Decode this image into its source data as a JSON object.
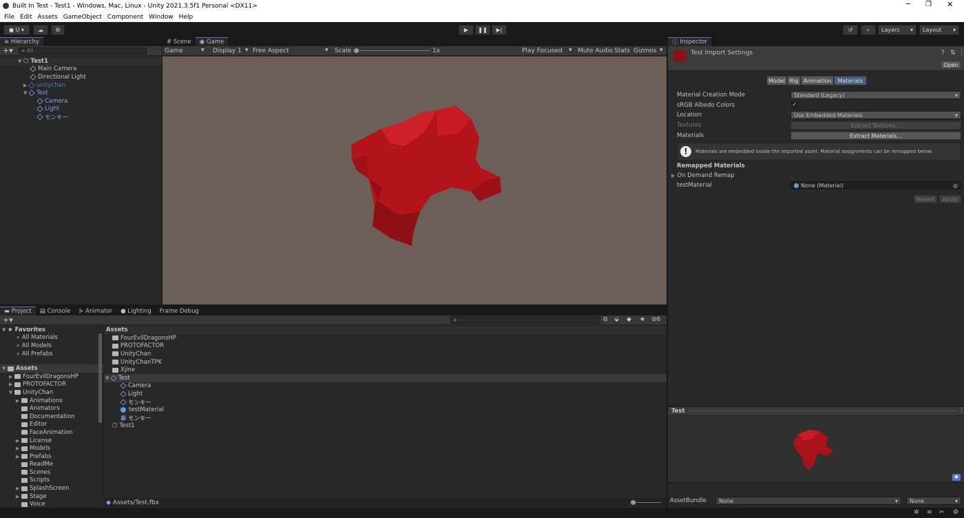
{
  "window": {
    "title": "Built In Test - Test1 - Windows, Mac, Linux - Unity 2021.3.5f1 Personal <DX11>"
  },
  "menu": [
    "File",
    "Edit",
    "Assets",
    "GameObject",
    "Component",
    "Window",
    "Help"
  ],
  "toolbar": {
    "account": "U",
    "layers": "Layers",
    "layout": "Layout"
  },
  "hierarchy": {
    "tab": "Hierarchy",
    "search_placeholder": "All",
    "scene": "Test1",
    "items": [
      {
        "label": "Main Camera"
      },
      {
        "label": "Directional Light"
      },
      {
        "label": "unitychan"
      },
      {
        "label": "Test"
      },
      {
        "label": "Camera"
      },
      {
        "label": "Light"
      },
      {
        "label": "モンキー"
      }
    ]
  },
  "game_view": {
    "tabs": [
      "Scene",
      "Game"
    ],
    "display_mode": "Game",
    "display": "Display 1",
    "aspect": "Free Aspect",
    "scale_label": "Scale",
    "scale_value": "1x",
    "play_focused": "Play Focused",
    "mute_audio": "Mute Audio",
    "stats": "Stats",
    "gizmos": "Gizmos"
  },
  "inspector": {
    "tab": "Inspector",
    "title": "Test Import Settings",
    "open_label": "Open",
    "tabs": [
      "Model",
      "Rig",
      "Animation",
      "Materials"
    ],
    "rows": {
      "creation_mode_label": "Material Creation Mode",
      "creation_mode_value": "Standard (Legacy)",
      "srgb_label": "sRGB Albedo Colors",
      "location_label": "Location",
      "location_value": "Use Embedded Materials",
      "textures_label": "Textures",
      "extract_textures": "Extract Textures...",
      "materials_label": "Materials",
      "extract_materials": "Extract Materials..."
    },
    "help": "Materials are embedded inside the imported asset. Material assignments can be remapped below.",
    "remapped_header": "Remapped Materials",
    "on_demand": "On Demand Remap",
    "test_material_label": "testMaterial",
    "test_material_value": "None (Material)",
    "revert": "Revert",
    "apply": "Apply",
    "preview_title": "Test",
    "assetbundle_label": "AssetBundle",
    "assetbundle_value": "None",
    "assetbundle_variant": "None"
  },
  "project": {
    "tabs": [
      "Project",
      "Console",
      "Animator",
      "Lighting",
      "Frame Debug"
    ],
    "count_badge": "6",
    "favorites_header": "Favorites",
    "favorites": [
      "All Materials",
      "All Models",
      "All Prefabs"
    ],
    "assets_header": "Assets",
    "tree_top": [
      "FourEvilDragonsHP",
      "PROTOFACTOR",
      "UnityChan"
    ],
    "unitychan_children": [
      "Animations",
      "Animators",
      "Documentation",
      "Editor",
      "FaceAnimation",
      "License",
      "Models",
      "Prefabs",
      "ReadMe",
      "Scenes",
      "Scripts",
      "SplashScreen",
      "Stage",
      "Voice"
    ],
    "list_header": "Assets",
    "list_folders": [
      "FourEvilDragonsHP",
      "PROTOFACTOR",
      "UnityChan",
      "UnityChanTPK",
      "Xjine"
    ],
    "list_test": "Test",
    "list_test_children": [
      "Camera",
      "Light",
      "モンキー",
      "testMaterial",
      "モンキー"
    ],
    "list_scene": "Test1",
    "footer_path": "Assets/Test.fbx"
  },
  "colors": {
    "accent": "#4c7cc7",
    "monkey": "#b3141c",
    "game_bg": "#6b5f57",
    "selected_tab": "#46607c"
  }
}
